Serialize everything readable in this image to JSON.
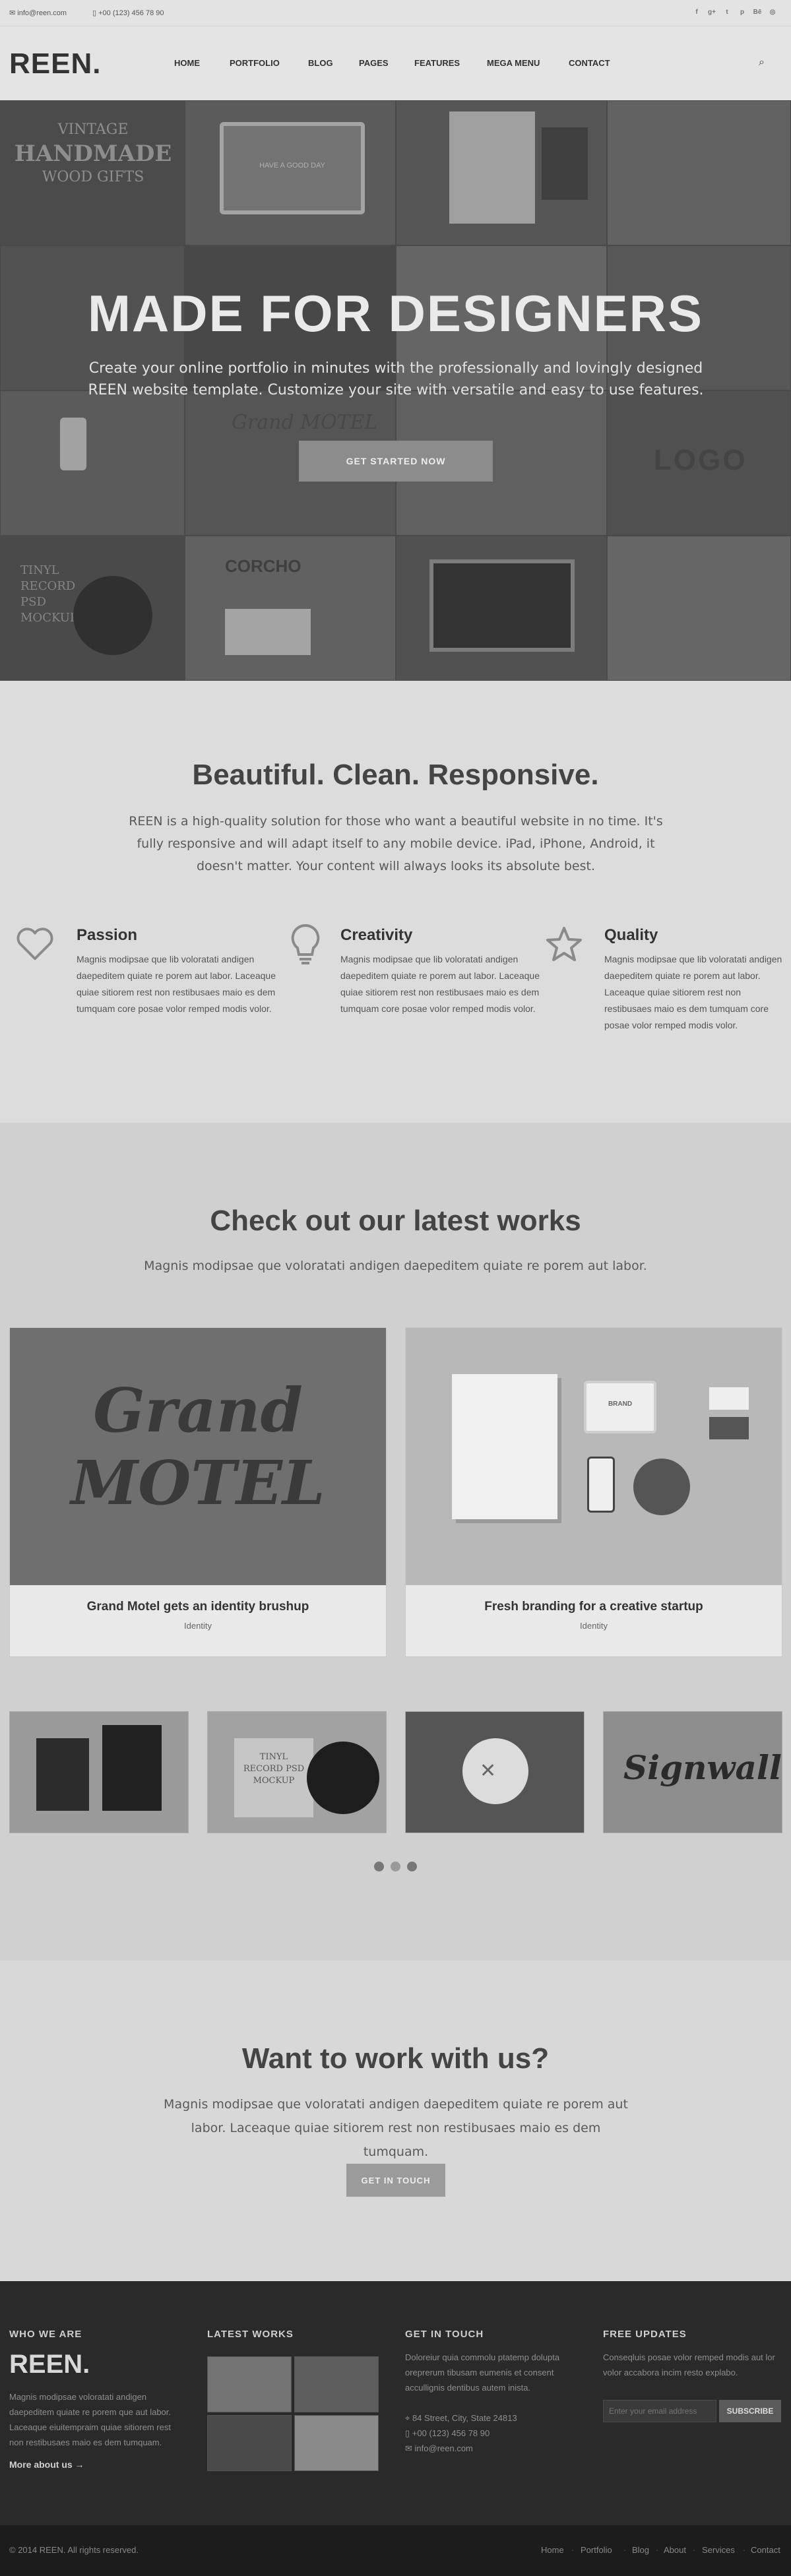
{
  "topbar": {
    "email": "info@reen.com",
    "phone": "+00 (123) 456 78 90",
    "social_icons": [
      "facebook-icon",
      "google-plus-icon",
      "twitter-icon",
      "pinterest-icon",
      "behance-icon",
      "dribbble-icon"
    ]
  },
  "header": {
    "logo": "REEN.",
    "nav": [
      "HOME",
      "PORTFOLIO",
      "BLOG",
      "PAGES",
      "FEATURES",
      "MEGA MENU",
      "CONTACT"
    ],
    "search_icon": "search-icon"
  },
  "hero": {
    "title": "MADE FOR DESIGNERS",
    "subtitle": "Create your online portfolio in minutes with the professionally and lovingly designed REEN website template. Customize your site with versatile and easy to use features.",
    "button": "GET STARTED NOW",
    "tile_words": [
      "VINTAGE",
      "HANDMADE",
      "WOOD GIFTS",
      "HAVE A GOOD DAY",
      "Grand MOTEL",
      "LOGO",
      "CORCHO",
      "TINYL RECORD PSD MOCKUP"
    ]
  },
  "intro": {
    "title": "Beautiful. Clean. Responsive.",
    "text": "REEN is a high-quality solution for those who want a beautiful website in no time. It's fully responsive and will adapt itself to any mobile device. iPad, iPhone, Android, it doesn't matter. Your content will always looks its absolute best.",
    "features": [
      {
        "title": "Passion",
        "icon": "heart-icon",
        "text": "Magnis modipsae que lib voloratati andigen daepeditem quiate re porem aut labor. Laceaque quiae sitiorem rest non restibusaes maio es dem tumquam core posae volor remped modis volor."
      },
      {
        "title": "Creativity",
        "icon": "lightbulb-icon",
        "text": "Magnis modipsae que lib voloratati andigen daepeditem quiate re porem aut labor. Laceaque quiae sitiorem rest non restibusaes maio es dem tumquam core posae volor remped modis volor."
      },
      {
        "title": "Quality",
        "icon": "star-icon",
        "text": "Magnis modipsae que lib voloratati andigen daepeditem quiate re porem aut labor. Laceaque quiae sitiorem rest non restibusaes maio es dem tumquam core posae volor remped modis volor."
      }
    ]
  },
  "works": {
    "title": "Check out our latest works",
    "subtitle": "Magnis modipsae que voloratati andigen daepeditem quiate re porem aut labor.",
    "featured": [
      {
        "title": "Grand Motel gets an identity brushup",
        "category": "Identity",
        "img_text": "Grand MOTEL"
      },
      {
        "title": "Fresh branding for a creative startup",
        "category": "Identity",
        "img_text": "BRAND"
      }
    ],
    "thumbs": [
      "TINYL RECORD PSD MOCKUP",
      "Signwall"
    ]
  },
  "cta": {
    "title": "Want to work with us?",
    "text": "Magnis modipsae que voloratati andigen daepeditem quiate re porem aut labor. Laceaque quiae sitiorem rest non restibusaes maio es dem tumquam.",
    "button": "GET IN TOUCH"
  },
  "footer": {
    "who_title": "WHO WE ARE",
    "logo": "REEN.",
    "who_text": "Magnis modipsae voloratati andigen daepeditem quiate re porem que aut labor. Laceaque eiuitempraim quiae sitiorem rest non restibusaes maio es dem tumquam.",
    "more_link": "More about us →",
    "latest_title": "LATEST WORKS",
    "touch_title": "GET IN TOUCH",
    "touch_text": "Doloreiur quia commolu ptatemp dolupta oreprerum tibusam eumenis et consent accullignis dentibus autem inista.",
    "address": "84 Street, City, State 24813",
    "phone": "+00 (123) 456 78 90",
    "email": "info@reen.com",
    "updates_title": "FREE UPDATES",
    "updates_text": "Conseqluis posae volor remped modis aut lor volor accabora incim resto explabo.",
    "email_placeholder": "Enter your email address",
    "subscribe": "SUBSCRIBE"
  },
  "bottom": {
    "copyright": "© 2014 REEN. All rights reserved.",
    "links": [
      "Home",
      "Portfolio",
      "Blog",
      "About",
      "Services",
      "Contact"
    ]
  }
}
